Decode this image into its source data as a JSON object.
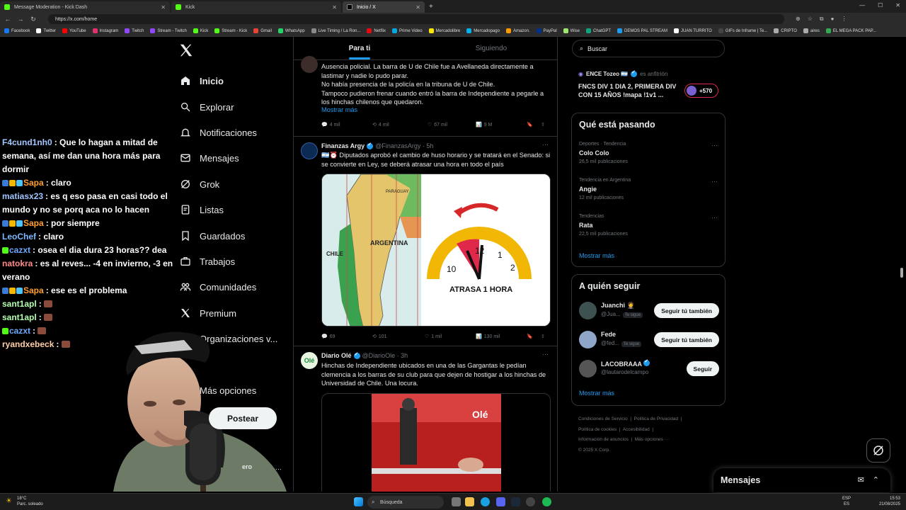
{
  "browser": {
    "tabs": [
      {
        "title": "Message Moderation - Kick Dash",
        "color": "#53fc18"
      },
      {
        "title": "Kick",
        "color": "#53fc18"
      },
      {
        "title": "Inicio / X",
        "color": "#ffffff"
      }
    ],
    "url": "https://x.com/home",
    "bookmarks": [
      "Facebook",
      "Twitter",
      "YouTube",
      "Instagram",
      "Twitch",
      "Stream - Twitch",
      "Kick",
      "Stream - Kick",
      "Gmail",
      "WhatsApp",
      "Live Timing / La Ron...",
      "Netflix",
      "Prime Video",
      "Mercadolibre",
      "Mercadopago",
      "Amazon.",
      "PayPal",
      "Wise",
      "ChatGPT",
      "DEMOS PAL STREAM",
      "JUAN TURRITO",
      "GIFs de Inframe | Te...",
      "CRIPTO",
      "aires",
      "EL MEGA PACK PAP..."
    ]
  },
  "chat": [
    {
      "user": "F4cund1nh0",
      "color": "#a2c8ff",
      "badges": [],
      "text": "Que lo hagan a mitad de semana, así me dan una hora más para dormir"
    },
    {
      "user": "Sapa",
      "color": "#ff9f2e",
      "badges": [
        "#3a7bd5",
        "#f5b800",
        "#4fc3f7"
      ],
      "text": "claro"
    },
    {
      "user": "matiasx23",
      "color": "#9ec6ff",
      "badges": [],
      "text": "es q eso pasa en casi todo el mundo y no se porq aca no lo hacen"
    },
    {
      "user": "Sapa",
      "color": "#ff9f2e",
      "badges": [
        "#3a7bd5",
        "#f5b800",
        "#4fc3f7"
      ],
      "text": "por siempre"
    },
    {
      "user": "LeoChef",
      "color": "#7cb8ff",
      "badges": [],
      "text": "claro"
    },
    {
      "user": "cazxt",
      "color": "#6fa8ff",
      "badges": [
        "#53fc18"
      ],
      "text": "osea el dia dura 23 horas?? dea"
    },
    {
      "user": "natokra",
      "color": "#ff8a8a",
      "badges": [],
      "text": "es al reves... -4 en invierno, -3 en verano"
    },
    {
      "user": "Sapa",
      "color": "#ff9f2e",
      "badges": [
        "#3a7bd5",
        "#f5b800",
        "#4fc3f7"
      ],
      "text": "ese es el problema"
    },
    {
      "user": "sant1apl",
      "color": "#b6ffb0",
      "badges": [],
      "text": "",
      "emote": true
    },
    {
      "user": "sant1apl",
      "color": "#b6ffb0",
      "badges": [],
      "text": "",
      "emote": true
    },
    {
      "user": "cazxt",
      "color": "#6fa8ff",
      "badges": [
        "#53fc18"
      ],
      "text": "",
      "emote": true
    },
    {
      "user": "ryandxebeck",
      "color": "#ffd0a8",
      "badges": [],
      "text": "",
      "emote": true
    }
  ],
  "nav": {
    "items": [
      "Inicio",
      "Explorar",
      "Notificaciones",
      "Mensajes",
      "Grok",
      "Listas",
      "Guardados",
      "Trabajos",
      "Comunidades",
      "Premium",
      "Organizaciones v...",
      "Más opciones"
    ],
    "post_label": "Postear",
    "profile_suffix": "ero",
    "more_dots": "···"
  },
  "feed": {
    "tabs": [
      "Para ti",
      "Siguiendo"
    ],
    "tweet1": {
      "text": "Ausencia policial. La barra de U de Chile fue a Avellaneda directamente a lastimar y nadie lo pudo parar.\nNo había presencia de la policía en la tribuna de U de Chile.\nTampoco pudieron frenar cuando entró la barra de Independiente a pegarle a los hinchas chilenos que quedaron.",
      "show_more": "Mostrar más",
      "replies": "4 mil",
      "reposts": "4 mil",
      "likes": "67 mil",
      "views": "9 M"
    },
    "tweet2": {
      "name": "Finanzas Argy",
      "handle": "@FinanzasArgy · 5h",
      "text": "🇦🇷⏰ Diputados aprobó el cambio de huso horario y se tratará en el Senado: si se convierte en Ley, se deberá atrasar una hora en todo el país",
      "image_label": "ATRASA 1 HORA",
      "map_label": "ARGENTINA",
      "chile_label": "CHILE",
      "paraguay_label": "PARAGUAY",
      "clock_numbers": [
        "10",
        "12",
        "1",
        "2"
      ],
      "replies": "69",
      "reposts": "101",
      "likes": "1 mil",
      "views": "130 mil"
    },
    "tweet3": {
      "name": "Diario Olé",
      "handle": "@DiarioOle · 3h",
      "text": "Hinchas de Independiente ubicados en una de las Gargantas le pedían clemencia a los barras de su club para que dejen de hostigar a los hinchas de Universidad de Chile. Una locura.",
      "image_watermark": "Olé"
    }
  },
  "sidebar": {
    "search_placeholder": "Buscar",
    "space": {
      "host": "ENCE Tozeo 🇦🇷",
      "role": "es anfitrión",
      "title": "FNCS DIV 1 DIA 2, PRIMERA DIV CON 15 AÑOS !mapa !1v1 ...",
      "count": "+570"
    },
    "trends_title": "Qué está pasando",
    "trends": [
      {
        "category": "Deportes · Tendencia",
        "name": "Colo Colo",
        "count": "26,5 mil publicaciones"
      },
      {
        "category": "Tendencia en Argentina",
        "name": "Angie",
        "count": "12 mil publicaciones"
      },
      {
        "category": "Tendencias",
        "name": "Rata",
        "count": "22,5 mil publicaciones"
      }
    ],
    "show_more": "Mostrar más",
    "follow_title": "A quién seguir",
    "follow": [
      {
        "name": "Juanchi 🤵",
        "handle": "@Jua...",
        "tag": "Te sigue",
        "button": "Seguir tú también"
      },
      {
        "name": "Fede",
        "handle": "@fed...",
        "tag": "Te sigue",
        "button": "Seguir tú también"
      },
      {
        "name": "LACOBRAAA",
        "handle": "@lautarodelcampo",
        "tag": "",
        "button": "Seguir"
      }
    ],
    "follow_more": "Mostrar más",
    "footer": [
      "Condiciones de Servicio",
      "Política de Privacidad",
      "Política de cookies",
      "Accesibilidad",
      "Información de anuncios",
      "Más opciones ···",
      "© 2025 X Corp."
    ]
  },
  "messages_drawer": {
    "title": "Mensajes"
  },
  "taskbar": {
    "weather_temp": "18°C",
    "weather_desc": "Parc. soleado",
    "search": "Búsqueda",
    "lang_top": "ESP",
    "lang_bottom": "ES",
    "time": "15:53",
    "date": "21/08/2025"
  }
}
